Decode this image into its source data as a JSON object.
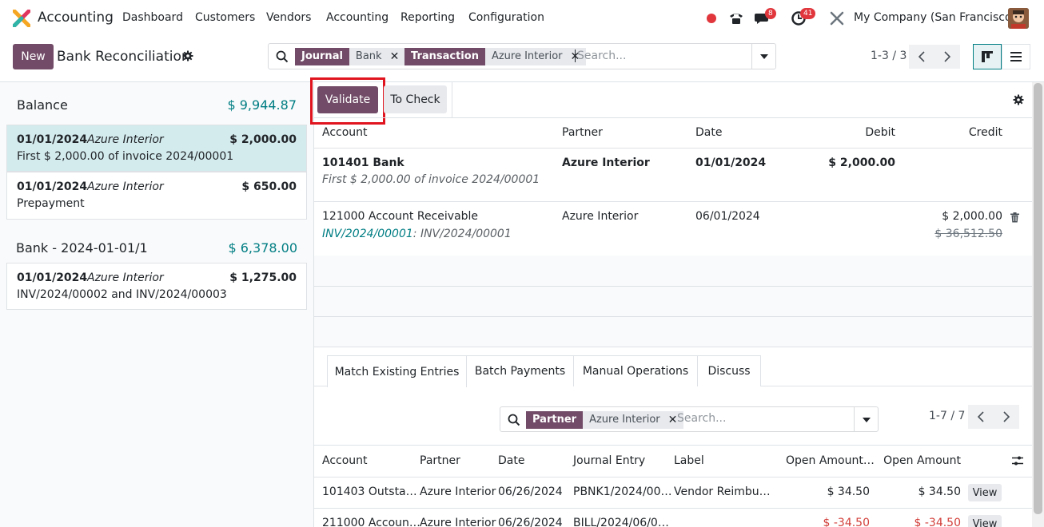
{
  "nav": {
    "app_name": "Accounting",
    "menu": [
      "Dashboard",
      "Customers",
      "Vendors",
      "Accounting",
      "Reporting",
      "Configuration"
    ],
    "messages_badge": "8",
    "activities_badge": "41",
    "company": "My Company (San Francisco)"
  },
  "control": {
    "new_label": "New",
    "breadcrumb": "Bank Reconciliation",
    "facets": [
      {
        "key": "Journal",
        "value": "Bank"
      },
      {
        "key": "Transaction",
        "value": "Azure Interior"
      }
    ],
    "search_placeholder": "Search...",
    "pager": "1-3 / 3"
  },
  "left": {
    "groups": [
      {
        "title": "Balance",
        "amount": "$ 9,944.87",
        "lines": [
          {
            "date": "01/01/2024",
            "partner": "Azure Interior",
            "amount": "$ 2,000.00",
            "label": "First $ 2,000.00 of invoice 2024/00001",
            "selected": true
          },
          {
            "date": "01/01/2024",
            "partner": "Azure Interior",
            "amount": "$ 650.00",
            "label": "Prepayment",
            "selected": false
          }
        ]
      },
      {
        "title": "Bank - 2024-01-01/1",
        "amount": "$ 6,378.00",
        "lines": [
          {
            "date": "01/01/2024",
            "partner": "Azure Interior",
            "amount": "$ 1,275.00",
            "label": "INV/2024/00002 and INV/2024/00003",
            "selected": false
          }
        ]
      }
    ]
  },
  "right": {
    "validate_label": "Validate",
    "tocheck_label": "To Check",
    "columns": [
      "Account",
      "Partner",
      "Date",
      "Debit",
      "Credit"
    ],
    "lines": [
      {
        "account": "101401 Bank",
        "sub": "First $ 2,000.00 of invoice 2024/00001",
        "partner": "Azure Interior",
        "date": "01/01/2024",
        "debit": "$ 2,000.00",
        "credit": ""
      },
      {
        "account": "121000 Account Receivable",
        "sub_link": "INV/2024/00001",
        "sub_rest": ": INV/2024/00001",
        "partner": "Azure Interior",
        "date": "06/01/2024",
        "debit": "",
        "credit": "$ 2,000.00",
        "credit_struck": "$ 36,512.50"
      }
    ],
    "tabs": [
      "Match Existing Entries",
      "Batch Payments",
      "Manual Operations",
      "Discuss"
    ],
    "match": {
      "facet_key": "Partner",
      "facet_value": "Azure Interior",
      "search_placeholder": "Search...",
      "pager": "1-7 / 7",
      "columns": [
        "Account",
        "Partner",
        "Date",
        "Journal Entry",
        "Label",
        "Open Amount…",
        "Open Amount"
      ],
      "rows": [
        {
          "account": "101403 Outsta…",
          "partner": "Azure Interior",
          "date": "06/26/2024",
          "entry": "PBNK1/2024/00…",
          "label": "Vendor Reimbu…",
          "open_cur": "$ 34.50",
          "open": "$ 34.50",
          "view": "View"
        },
        {
          "account": "211000 Accoun…",
          "partner": "Azure Interior",
          "date": "06/26/2024",
          "entry": "BILL/2024/06/0…",
          "label": "",
          "open_cur": "$ -34.50",
          "open": "$ -34.50",
          "view": "View"
        }
      ]
    }
  },
  "colors": {
    "brand": "#714b67",
    "teal": "#017e84",
    "selected": "#d4ebee",
    "highlight": "#e0141e"
  }
}
